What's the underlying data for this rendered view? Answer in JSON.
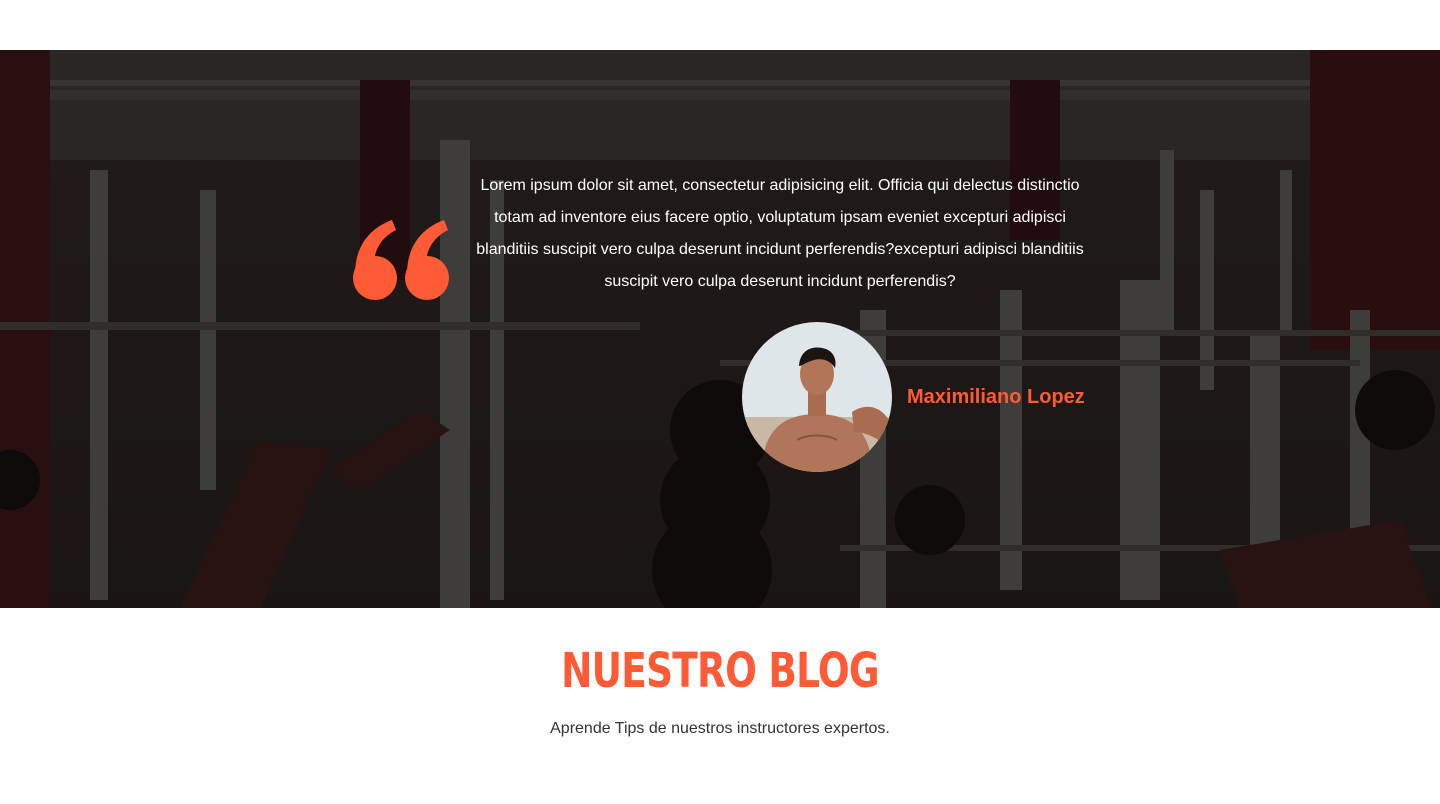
{
  "colors": {
    "accent": "#ff5a36",
    "overlay": "#000000",
    "text_light": "#ffffff",
    "text_dark": "#333333"
  },
  "testimonial": {
    "quote_icon": "quote-open-icon",
    "text": "Lorem ipsum dolor sit amet, consectetur adipisicing elit. Officia qui delectus distinctio totam ad inventore eius facere optio, voluptatum ipsam eveniet excepturi adipisci blanditiis suscipit vero culpa deserunt incidunt perferendis?excepturi adipisci blanditiis suscipit vero culpa deserunt incidunt perferendis?",
    "author_name": "Maximiliano Lopez"
  },
  "blog": {
    "title": "Nuestro Blog",
    "subtitle": "Aprende Tips de nuestros instructores expertos."
  }
}
